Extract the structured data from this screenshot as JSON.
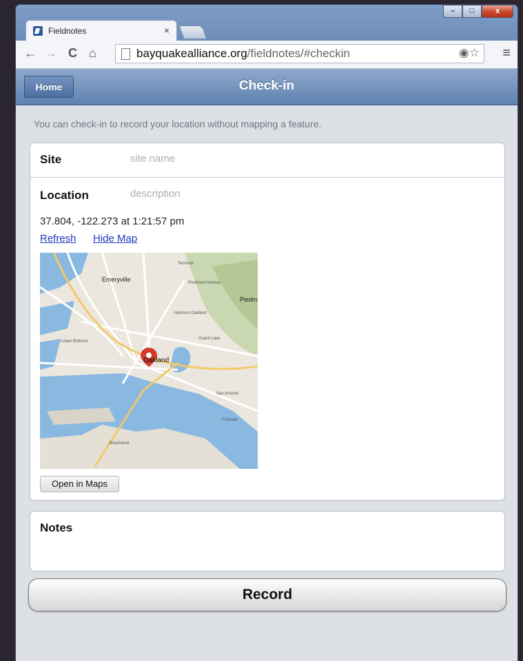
{
  "browser": {
    "tab_title": "Fieldnotes",
    "tab_close": "×",
    "url_host": "bayquakealliance.org",
    "url_path": "/fieldnotes/#checkin",
    "back_icon": "←",
    "forward_icon": "→",
    "reload_icon": "C",
    "home_icon": "⌂",
    "omni_icons": "◉☆",
    "menu_icon": "≡",
    "window_controls": {
      "minimize": "–",
      "maximize": "□",
      "close": "x"
    }
  },
  "header": {
    "home_label": "Home",
    "title": "Check-in"
  },
  "intro": "You can check-in to record your location without mapping a feature.",
  "site": {
    "label": "Site",
    "placeholder": "site name"
  },
  "location": {
    "label": "Location",
    "placeholder": "description",
    "coords": "37.804, -122.273 at 1:21:57 pm",
    "refresh_label": "Refresh",
    "hide_map_label": "Hide Map",
    "open_maps_label": "Open in Maps",
    "map_labels": {
      "emeryville": "Emeryville",
      "piedmont": "Piedmon",
      "oakland": "Oakland",
      "terminal": "Terminal",
      "piedmont_ave": "Piedmont Avenue",
      "lower_bottoms": "Lower Bottoms",
      "grand_lake": "Grand Lake",
      "san_antonio": "San Antonio",
      "fruitvale": "Fruitvale",
      "alameda": "Woodstock",
      "harrison": "Harrison Oakland"
    }
  },
  "notes": {
    "label": "Notes"
  },
  "record_label": "Record"
}
